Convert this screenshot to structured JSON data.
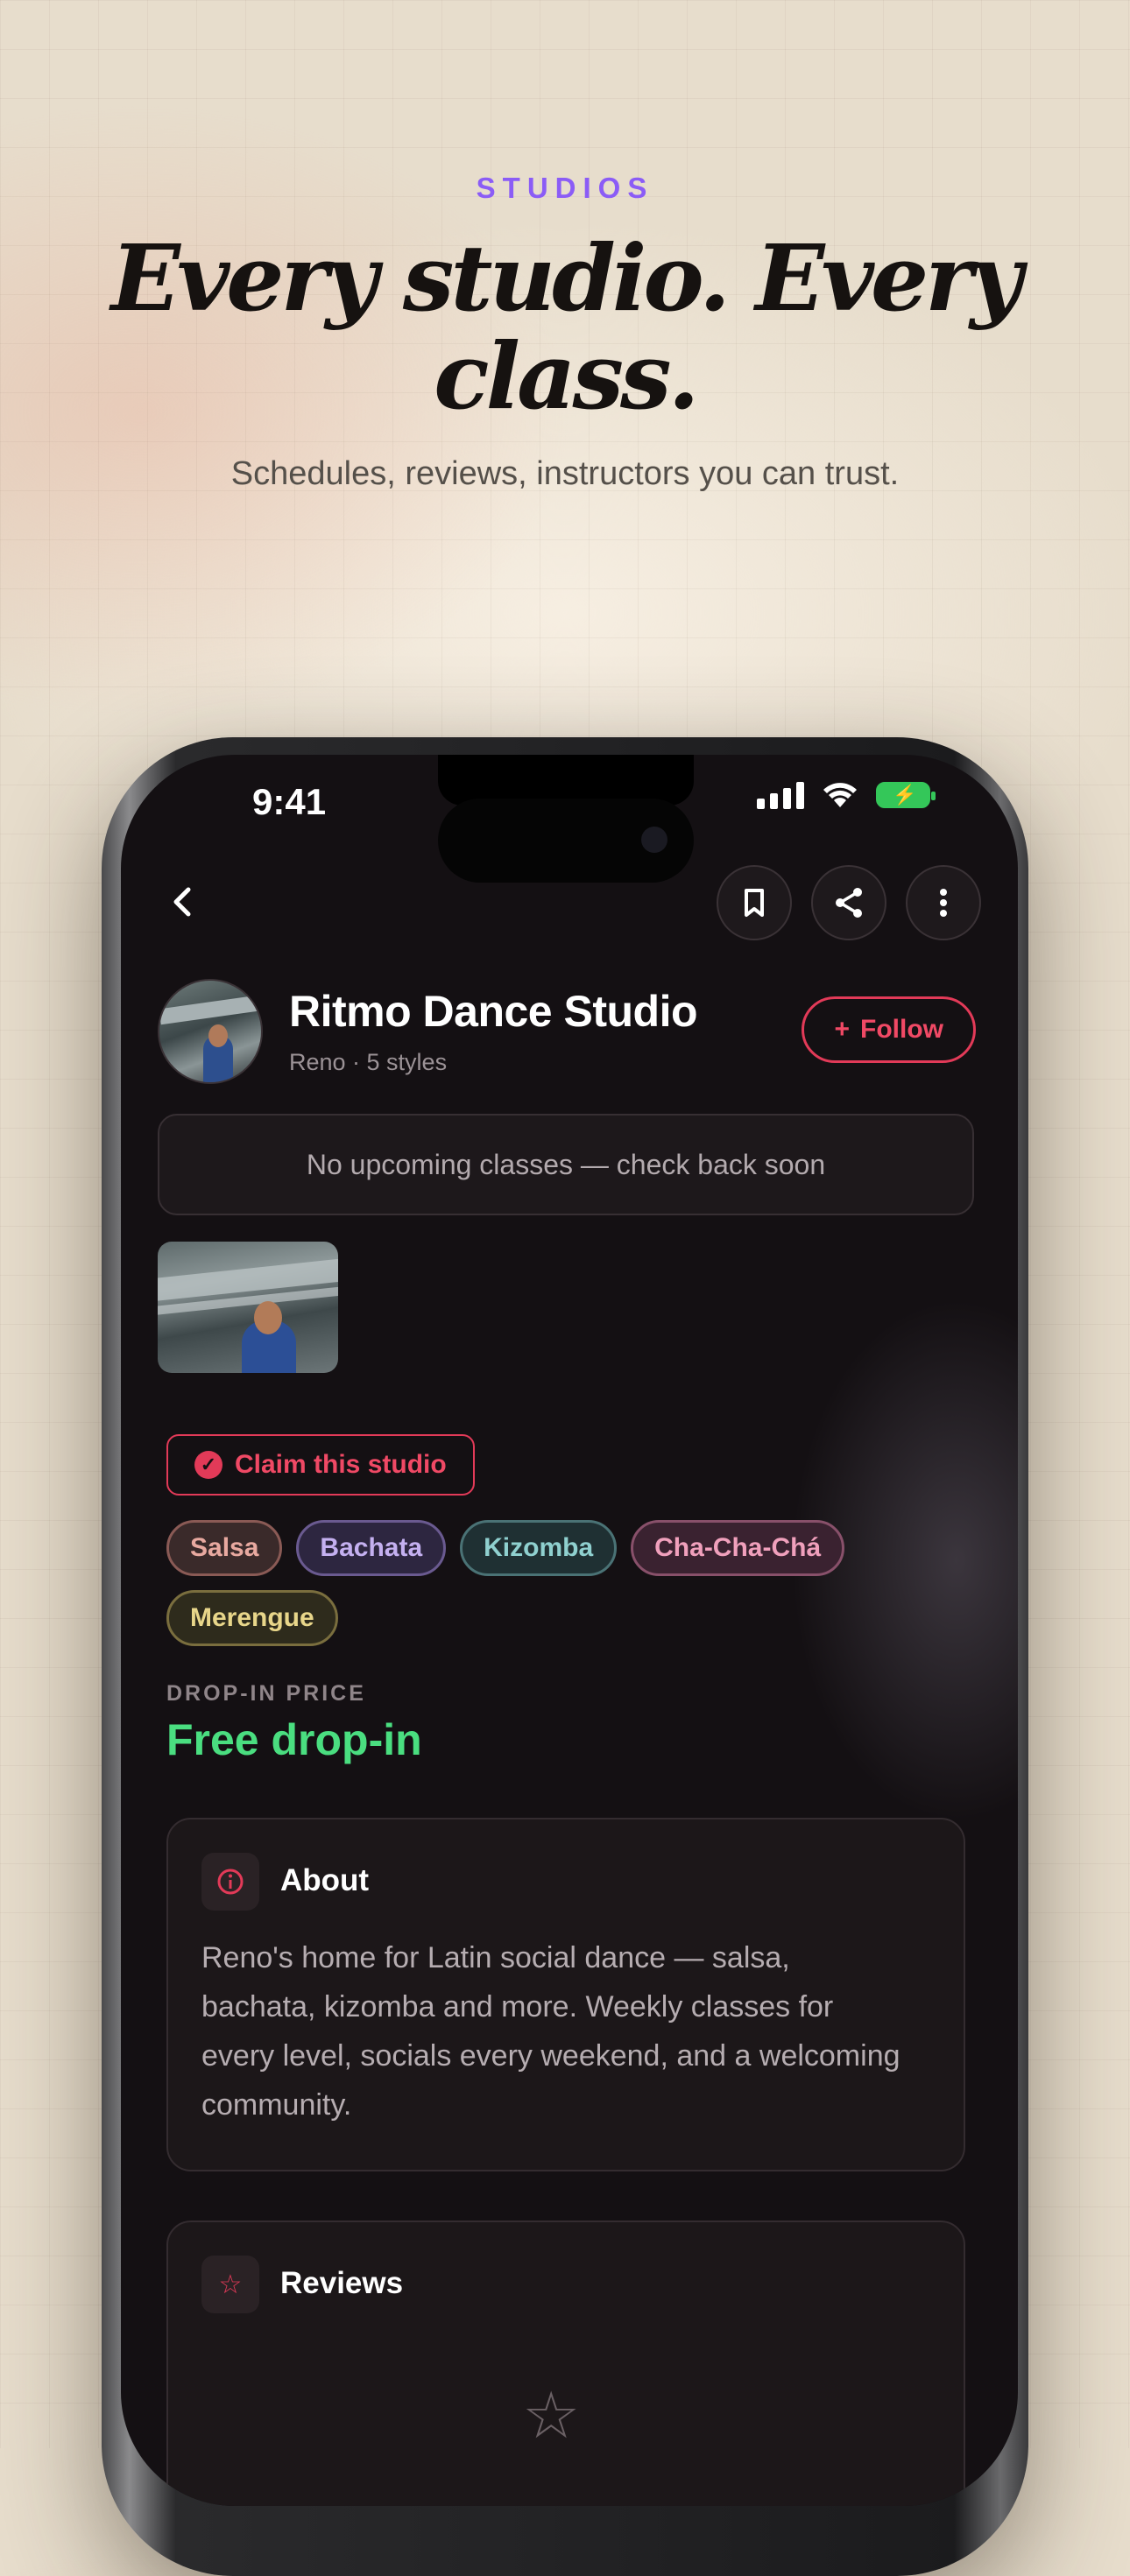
{
  "hero": {
    "eyebrow": "STUDIOS",
    "headline": "Every studio. Every class.",
    "subhead": "Schedules, reviews, instructors you can trust."
  },
  "status_bar": {
    "time": "9:41"
  },
  "nav": {
    "back_icon": "chevron-left-icon",
    "actions": [
      "bookmark-icon",
      "share-icon",
      "more-vertical-icon"
    ]
  },
  "studio": {
    "name": "Ritmo Dance Studio",
    "meta": "Reno · 5 styles",
    "follow_label": "Follow",
    "notice": "No upcoming classes — check back soon",
    "claim_label": "Claim this studio",
    "tags": [
      {
        "label": "Salsa",
        "color": "#e8a9a0",
        "border": "#8a5a55",
        "bg": "#3a2a2a"
      },
      {
        "label": "Bachata",
        "color": "#c4b0f0",
        "border": "#6a5a90",
        "bg": "#2d2640"
      },
      {
        "label": "Kizomba",
        "color": "#8fd0cf",
        "border": "#4a7275",
        "bg": "#1f3033"
      },
      {
        "label": "Cha-Cha-Chá",
        "color": "#f0a0bc",
        "border": "#88506a",
        "bg": "#3a2230"
      },
      {
        "label": "Merengue",
        "color": "#e8d68a",
        "border": "#7a6e3e",
        "bg": "#2e2b1c"
      }
    ],
    "price_label": "DROP-IN PRICE",
    "price_value": "Free drop-in"
  },
  "about": {
    "title": "About",
    "body": "Reno's home for Latin social dance — salsa, bachata, kizomba and more. Weekly classes for every level, socials every weekend, and a welcoming community."
  },
  "reviews": {
    "title": "Reviews"
  },
  "colors": {
    "accent": "#e23a58",
    "eyebrow": "#8b5cf6",
    "price": "#4ade80"
  }
}
